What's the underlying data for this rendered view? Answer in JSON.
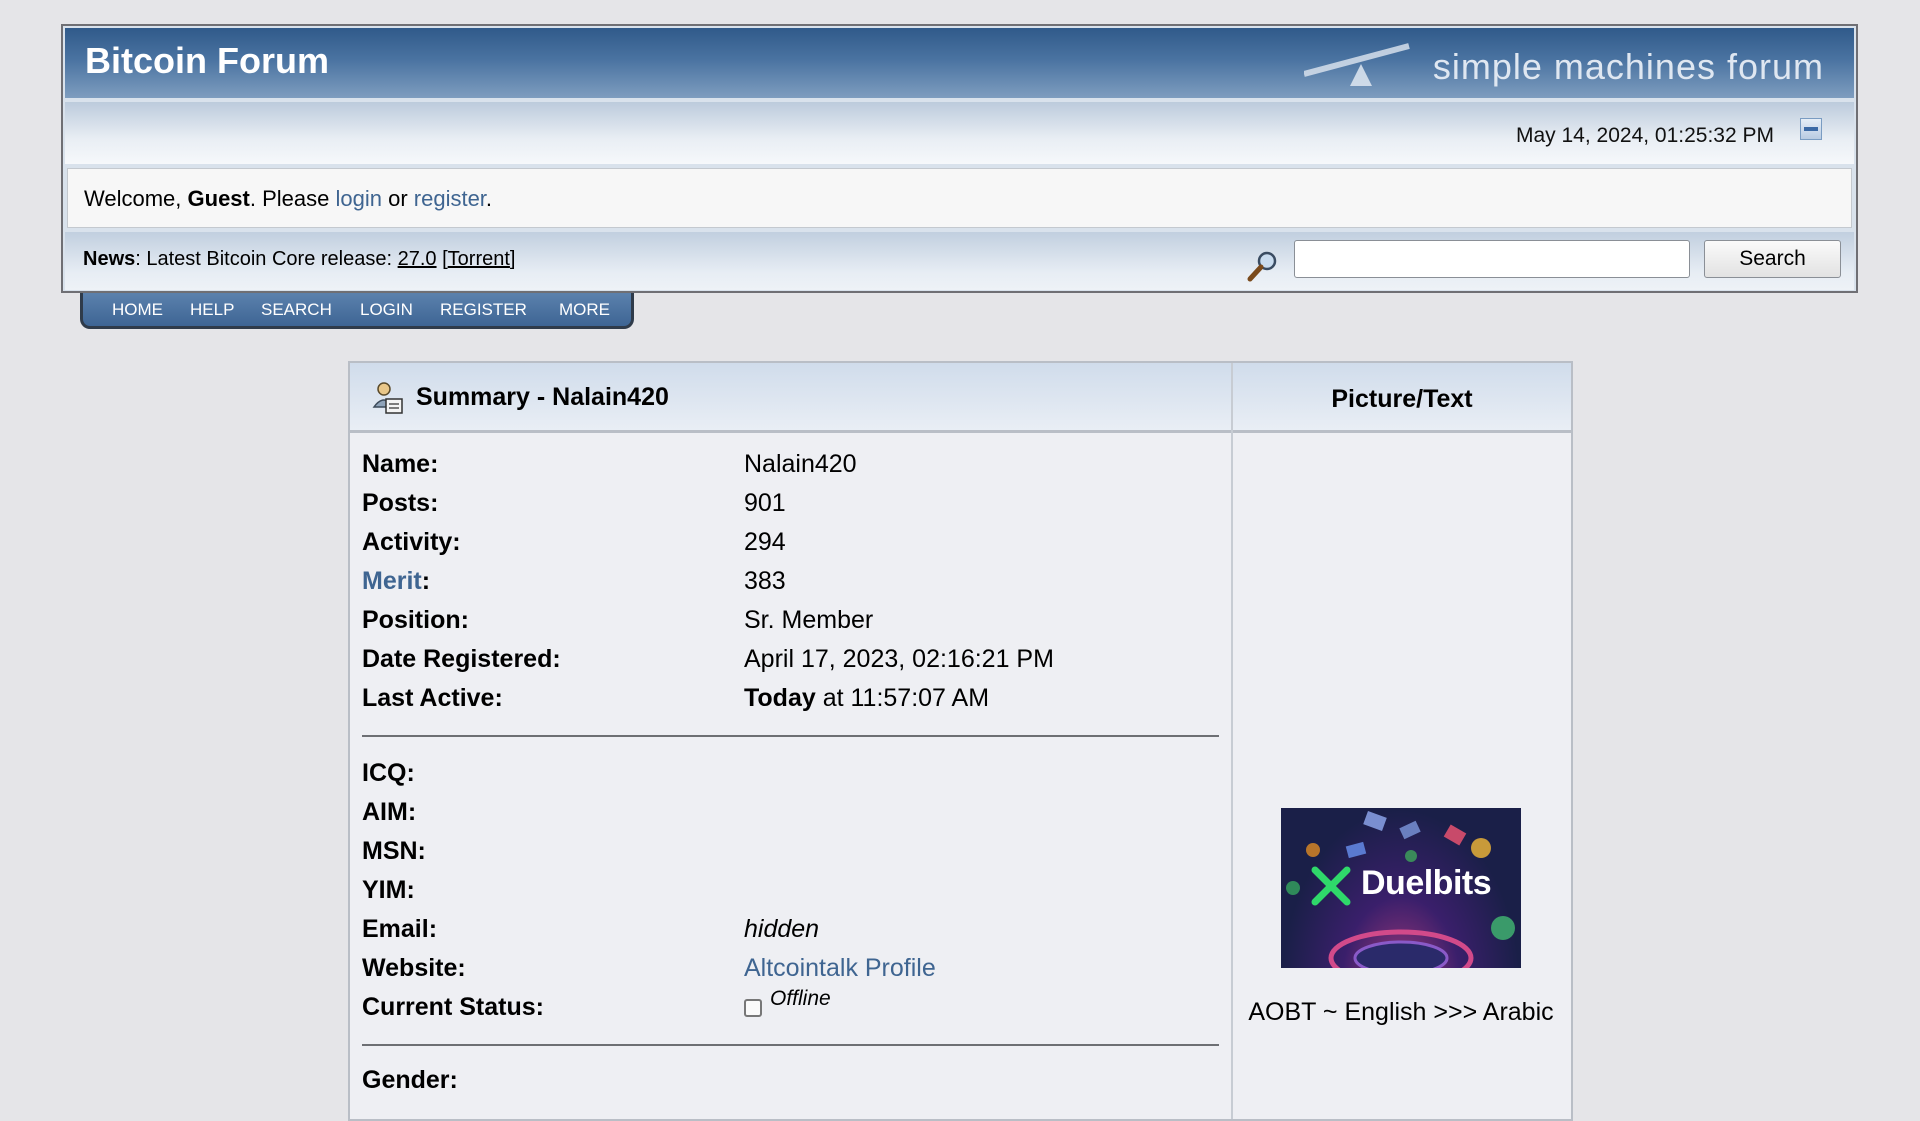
{
  "header": {
    "forum_title": "Bitcoin Forum",
    "logo_text": "simple machines forum",
    "datetime": "May 14, 2024, 01:25:32 PM"
  },
  "welcome": {
    "prefix": "Welcome, ",
    "user": "Guest",
    "mid": ". Please ",
    "login": "login",
    "or": " or ",
    "register": "register",
    "suffix": "."
  },
  "news": {
    "label": "News",
    "text": ": Latest Bitcoin Core release: ",
    "version_link": "27.0",
    "open_bracket": " [",
    "torrent_link": "Torrent",
    "close_bracket": "]"
  },
  "search": {
    "value": "",
    "button_label": "Search"
  },
  "nav": [
    "HOME",
    "HELP",
    "SEARCH",
    "LOGIN",
    "REGISTER",
    "MORE"
  ],
  "profile": {
    "summary_title": "Summary - Nalain420",
    "picture_title": "Picture/Text",
    "rows": [
      {
        "label": "Name:",
        "value": "Nalain420"
      },
      {
        "label": "Posts:",
        "value": "901"
      },
      {
        "label": "Activity:",
        "value": "294"
      },
      {
        "label": "Merit",
        "label_suffix": ":",
        "value": "383"
      },
      {
        "label": "Position:",
        "value": "Sr. Member"
      },
      {
        "label": "Date Registered:",
        "value": "April 17, 2023, 02:16:21 PM"
      },
      {
        "label": "Last Active:",
        "value_bold": "Today",
        "value": " at 11:57:07 AM"
      }
    ],
    "contact_rows": [
      {
        "label": "ICQ:",
        "value": ""
      },
      {
        "label": "AIM:",
        "value": ""
      },
      {
        "label": "MSN:",
        "value": ""
      },
      {
        "label": "YIM:",
        "value": ""
      },
      {
        "label": "Email:",
        "value": "hidden"
      },
      {
        "label": "Website:",
        "value": "Altcointalk Profile"
      },
      {
        "label": "Current Status:",
        "value": "Offline"
      }
    ],
    "next_label": "Gender:",
    "avatar_text": "Duelbits",
    "personal_text": "AOBT ~ English >>> Arabic"
  },
  "colors": {
    "header_blue": "#305a8a",
    "link": "#3f6591",
    "page_bg": "#e5e5e8"
  }
}
